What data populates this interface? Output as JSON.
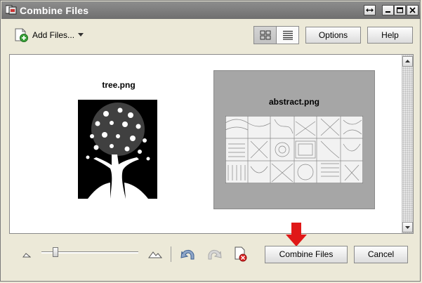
{
  "window": {
    "title": "Combine Files"
  },
  "toolbar": {
    "add_files_label": "Add Files...",
    "options_label": "Options",
    "help_label": "Help"
  },
  "files": [
    {
      "name": "tree.png"
    },
    {
      "name": "abstract.png",
      "selected": true
    }
  ],
  "footer": {
    "combine_label": "Combine Files",
    "cancel_label": "Cancel",
    "zoom_level": 0.12
  },
  "colors": {
    "title_bar": "#7d7d7d",
    "selection": "#a6a6a6",
    "arrow": "#e01818"
  },
  "icons": [
    "app-icon",
    "restore-icon",
    "minimize-icon",
    "maximize-icon",
    "close-icon",
    "add-files-icon",
    "chevron-down-icon",
    "thumbnail-view-icon",
    "list-view-icon",
    "zoom-out-icon",
    "zoom-in-icon",
    "undo-icon",
    "redo-icon",
    "remove-file-icon",
    "arrow-down-icon"
  ]
}
